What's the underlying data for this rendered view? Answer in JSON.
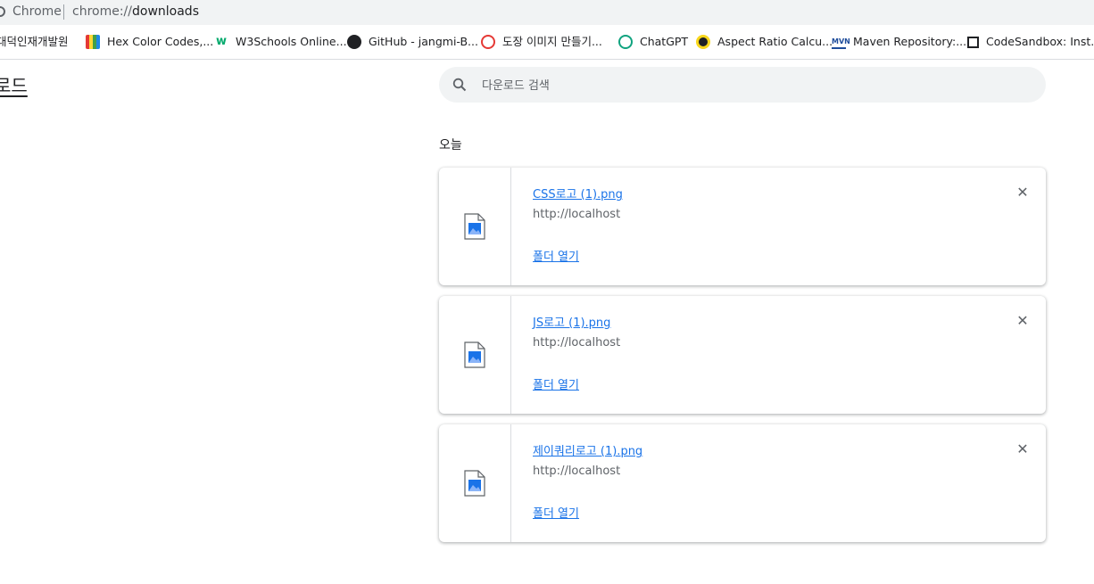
{
  "omnibox": {
    "chip": "Chrome",
    "url_scheme": "chrome://",
    "url_path": "downloads"
  },
  "bookmarks": [
    {
      "label": "대덕인재개발원",
      "icon": "none"
    },
    {
      "label": "Hex Color Codes,...",
      "icon": "books-icon"
    },
    {
      "label": "W3Schools Online...",
      "icon": "w3schools-icon"
    },
    {
      "label": "GitHub - jangmi-B...",
      "icon": "github-icon"
    },
    {
      "label": "도장 이미지 만들기...",
      "icon": "stamp-icon"
    },
    {
      "label": "ChatGPT",
      "icon": "chatgpt-icon"
    },
    {
      "label": "Aspect Ratio Calcu...",
      "icon": "aspect-ratio-icon"
    },
    {
      "label": "Maven Repository:...",
      "icon": "maven-icon"
    },
    {
      "label": "CodeSandbox: Inst...",
      "icon": "codesandbox-icon"
    }
  ],
  "page": {
    "title": "로드"
  },
  "search": {
    "placeholder": "다운로드 검색"
  },
  "date_header": "오늘",
  "downloads": [
    {
      "file_name": "CSS로고 (1).png",
      "url": "http://localhost",
      "open_folder": "폴더 열기"
    },
    {
      "file_name": "JS로고 (1).png",
      "url": "http://localhost",
      "open_folder": "폴더 열기"
    },
    {
      "file_name": "제이쿼리로고 (1).png",
      "url": "http://localhost",
      "open_folder": "폴더 열기"
    }
  ],
  "colors": {
    "link": "#1a73e8",
    "secondary_text": "#5f6368",
    "search_bg": "#f1f3f4"
  }
}
